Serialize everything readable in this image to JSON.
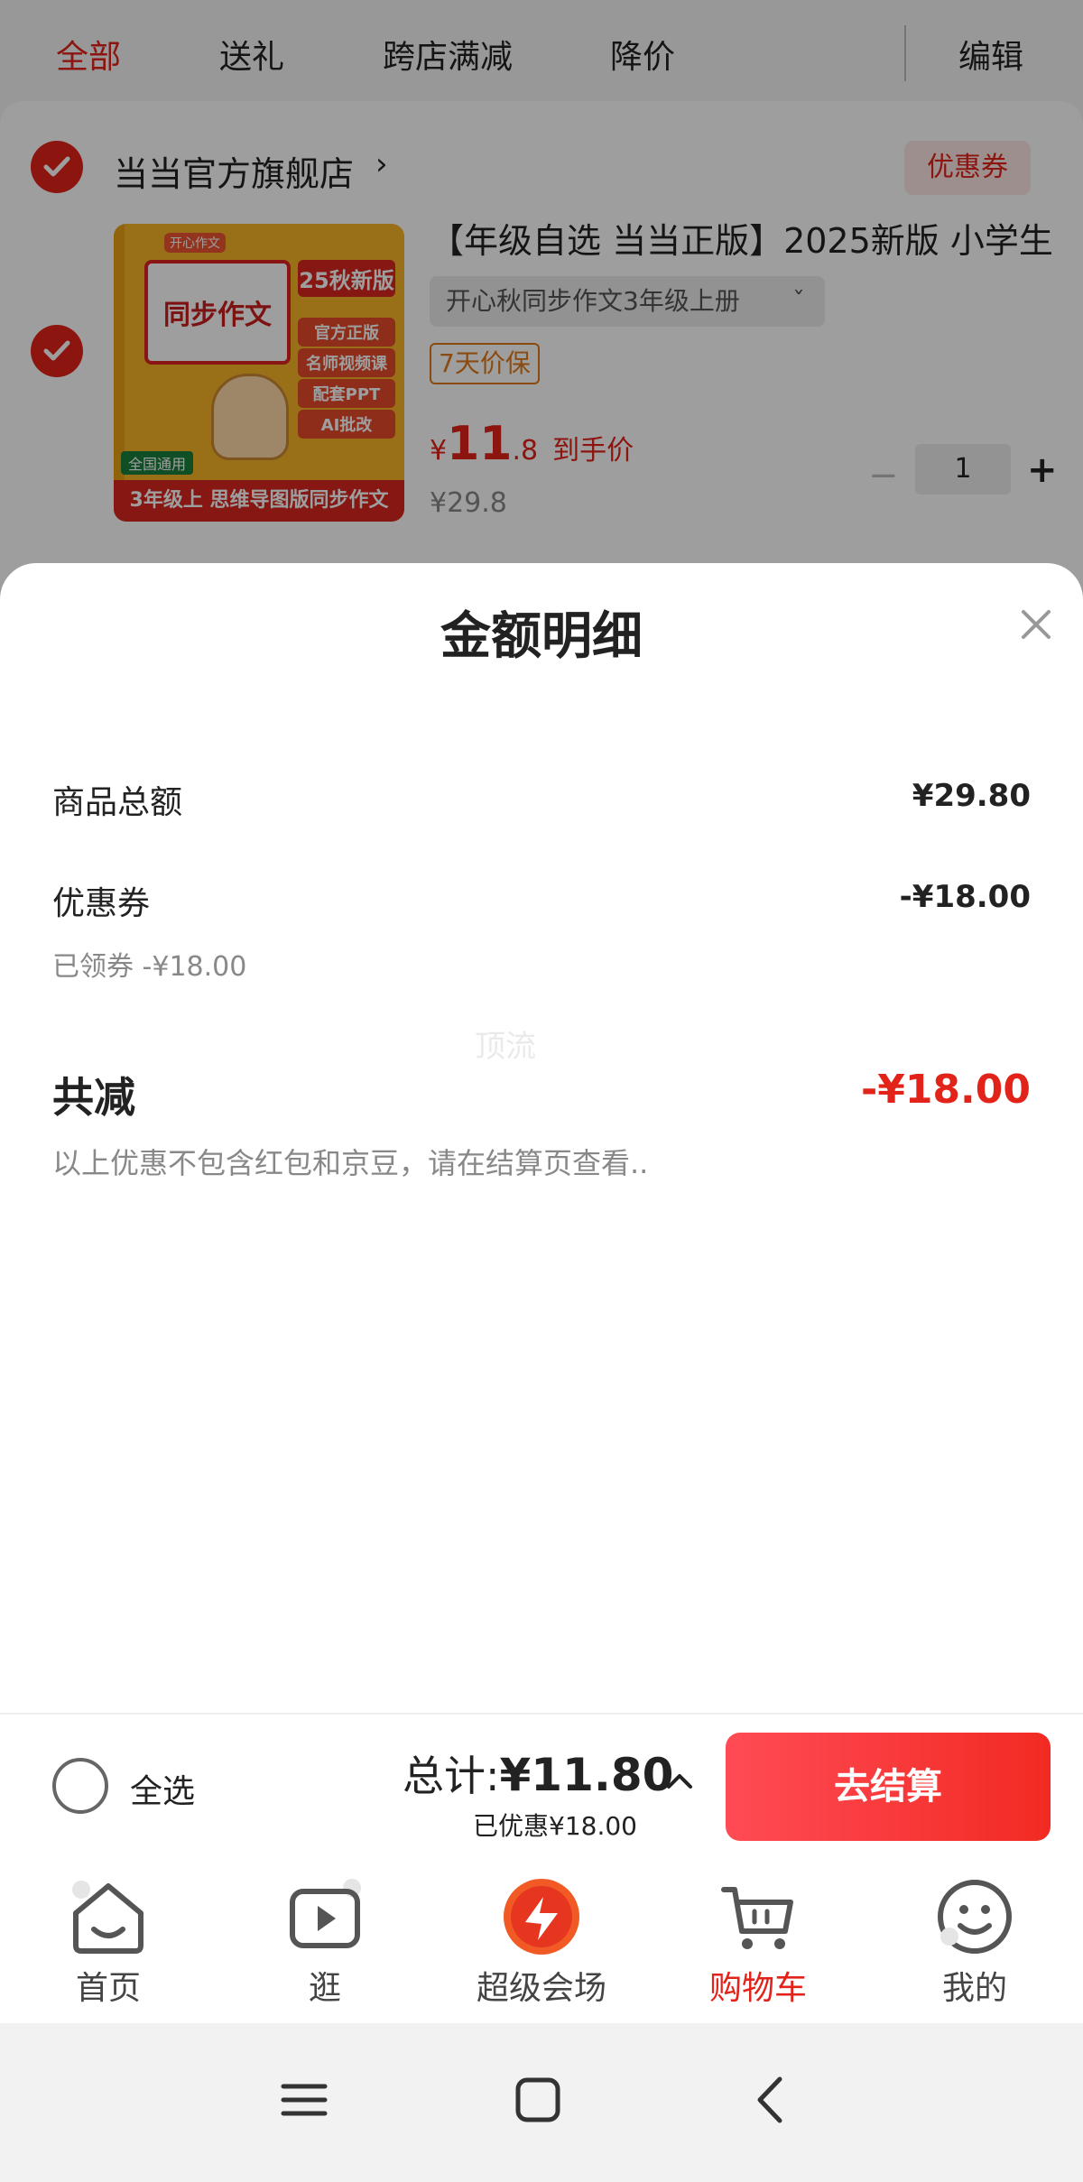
{
  "filter_bar": {
    "tabs": [
      {
        "label": "全部",
        "active": true
      },
      {
        "label": "送礼",
        "active": false
      },
      {
        "label": "跨店满减",
        "active": false
      },
      {
        "label": "降价",
        "active": false
      }
    ],
    "edit_label": "编辑"
  },
  "store": {
    "name": "当当官方旗舰店",
    "chevron": "›",
    "coupon_label": "优惠券"
  },
  "product": {
    "title": "【年级自选 当当正版】2025新版 小学生",
    "variant": "开心秋同步作文3年级上册",
    "variant_chevron": "ˇ",
    "price_protect": "7天价保",
    "price_symbol": "¥",
    "price_int": "11",
    "price_dec": ".8",
    "price_label": "到手价",
    "original_price": "¥29.8",
    "quantity": "1",
    "qty_minus": "−",
    "qty_plus": "+",
    "cover": {
      "top_tag": "开心作文",
      "title": "同步作文",
      "side_tags": [
        "25秋新版",
        "官方正版",
        "名师视频课",
        "配套PPT",
        "AI批改"
      ],
      "grade_tag": "全国通用",
      "bottom_text": "3年级上 思维导图版同步作文"
    }
  },
  "sheet": {
    "title": "金额明细",
    "close_icon": "close-icon",
    "rows": [
      {
        "label": "商品总额",
        "value": "¥29.80"
      },
      {
        "label": "优惠券",
        "value": "-¥18.00",
        "sub": "已领券 -¥18.00"
      }
    ],
    "watermark": "顶流",
    "total_label": "共减",
    "total_value": "-¥18.00",
    "note": "以上优惠不包含红包和京豆，请在结算页查看.."
  },
  "checkout": {
    "select_all_label": "全选",
    "total_label": "总计:",
    "total_amount": "¥11.80",
    "saved": "已优惠¥18.00",
    "button_label": "去结算"
  },
  "tabbar": {
    "tabs": [
      {
        "label": "首页",
        "icon": "home-icon",
        "active": false
      },
      {
        "label": "逛",
        "icon": "video-icon",
        "active": false
      },
      {
        "label": "超级会场",
        "icon": "super-venue-icon",
        "active": false
      },
      {
        "label": "购物车",
        "icon": "cart-icon",
        "active": true
      },
      {
        "label": "我的",
        "icon": "profile-icon",
        "active": false
      }
    ]
  },
  "system_nav": {
    "buttons": [
      "menu-icon",
      "home-square-icon",
      "back-icon"
    ]
  },
  "colors": {
    "accent": "#e2231a",
    "checkout_gradient_start": "#ff4b55",
    "checkout_gradient_end": "#f22a23",
    "price_protect": "#e07a1a"
  }
}
